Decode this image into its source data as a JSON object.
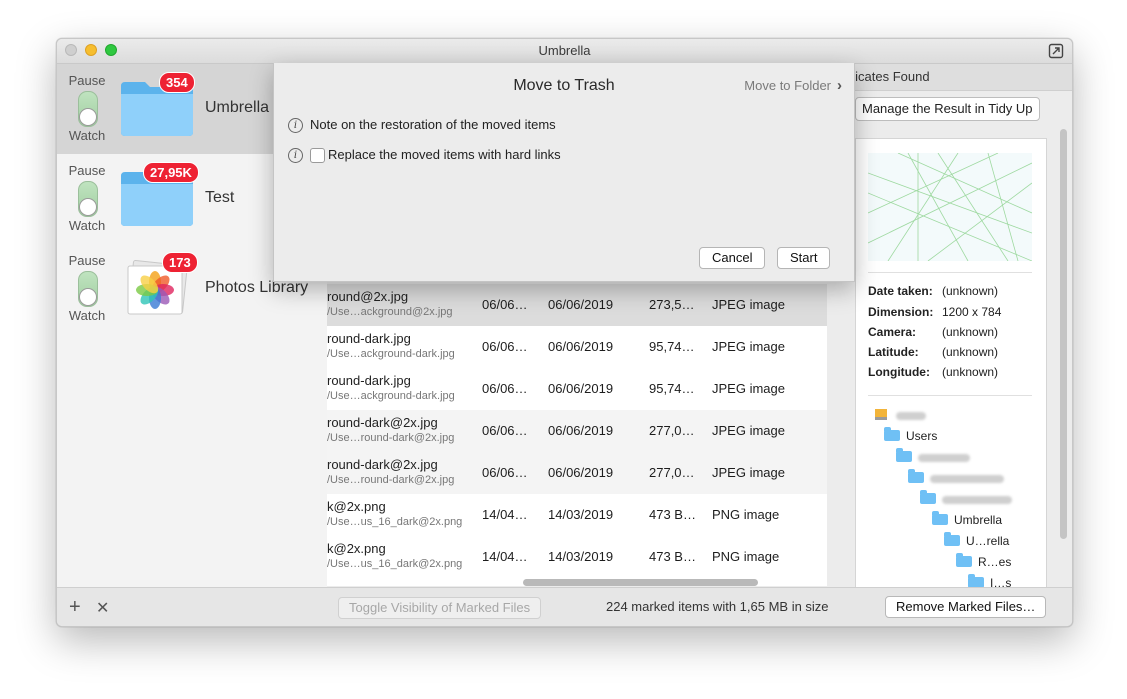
{
  "window": {
    "title": "Umbrella"
  },
  "sidebar": {
    "items": [
      {
        "pause": "Pause",
        "watch": "Watch",
        "badge": "354",
        "name": "Umbrella"
      },
      {
        "pause": "Pause",
        "watch": "Watch",
        "badge": "27,95K",
        "name": "Test"
      },
      {
        "pause": "Pause",
        "watch": "Watch",
        "badge": "173",
        "name": "Photos Library"
      }
    ]
  },
  "table": {
    "rows": [
      {
        "name": "round@2x.jpg",
        "path": "/Use…ackground@2x.jpg",
        "modified": "06/06…",
        "created": "06/06/2019",
        "size": "273,5…",
        "type": "JPEG image"
      },
      {
        "name": "round-dark.jpg",
        "path": "/Use…ackground-dark.jpg",
        "modified": "06/06…",
        "created": "06/06/2019",
        "size": "95,74…",
        "type": "JPEG image"
      },
      {
        "name": "round-dark.jpg",
        "path": "/Use…ackground-dark.jpg",
        "modified": "06/06…",
        "created": "06/06/2019",
        "size": "95,74…",
        "type": "JPEG image"
      },
      {
        "name": "round-dark@2x.jpg",
        "path": "/Use…round-dark@2x.jpg",
        "modified": "06/06…",
        "created": "06/06/2019",
        "size": "277,0…",
        "type": "JPEG image"
      },
      {
        "name": "round-dark@2x.jpg",
        "path": "/Use…round-dark@2x.jpg",
        "modified": "06/06…",
        "created": "06/06/2019",
        "size": "277,0…",
        "type": "JPEG image"
      },
      {
        "name": "k@2x.png",
        "path": "/Use…us_16_dark@2x.png",
        "modified": "14/04…",
        "created": "14/03/2019",
        "size": "473 B…",
        "type": "PNG image"
      },
      {
        "name": "k@2x.png",
        "path": "/Use…us_16_dark@2x.png",
        "modified": "14/04…",
        "created": "14/03/2019",
        "size": "473 B…",
        "type": "PNG image"
      }
    ]
  },
  "right": {
    "header": "plicates Found",
    "tidy_button": "Manage the Result in Tidy Up",
    "details": [
      {
        "key": "Date taken:",
        "value": "(unknown)"
      },
      {
        "key": "Dimension:",
        "value": "1200 x 784"
      },
      {
        "key": "Camera:",
        "value": "(unknown)"
      },
      {
        "key": "Latitude:",
        "value": "(unknown)"
      },
      {
        "key": "Longitude:",
        "value": "(unknown)"
      }
    ],
    "tree": [
      "Users",
      "Umbrella",
      "U…rella",
      "R…es",
      "I…s"
    ]
  },
  "bottom": {
    "toggle_button": "Toggle Visibility of Marked Files",
    "info": "224 marked items with 1,65 MB in size",
    "remove_button": "Remove Marked Files…",
    "add": "+",
    "remove_x": "✕"
  },
  "sheet": {
    "title": "Move to Trash",
    "move_to_folder": "Move to Folder",
    "note": "Note on the restoration of the moved items",
    "hardlinks": "Replace the moved items with hard links",
    "cancel": "Cancel",
    "start": "Start"
  },
  "colors": {
    "badge": "#ee2233",
    "folder": "#6fc0f5",
    "toggle": "#a2cfa2"
  },
  "icons": [
    "folder-icon",
    "photos-icon",
    "info-icon",
    "chevron-right-icon",
    "expand-icon",
    "drive-icon",
    "plus-icon",
    "close-icon"
  ]
}
